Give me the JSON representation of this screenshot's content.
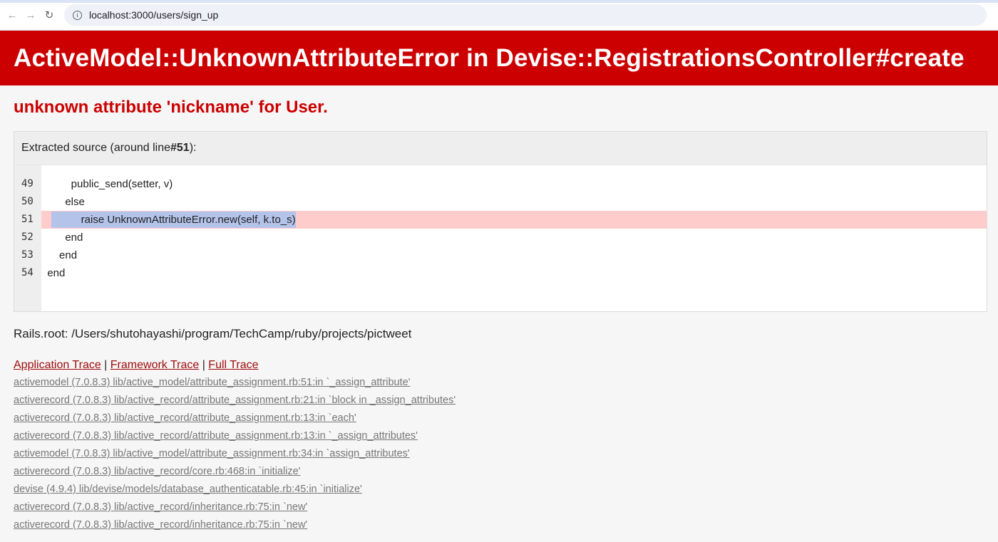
{
  "browser": {
    "url": "localhost:3000/users/sign_up",
    "back_icon": "arrow-left-icon",
    "forward_icon": "arrow-right-icon",
    "reload_icon": "reload-icon"
  },
  "error": {
    "title": "ActiveModel::UnknownAttributeError in Devise::RegistrationsController#create",
    "message": "unknown attribute 'nickname' for User."
  },
  "source": {
    "title_prefix": "Extracted source (around line ",
    "title_line": "#51",
    "title_suffix": "):",
    "line_numbers": [
      "49",
      "50",
      "51",
      "52",
      "53",
      "54"
    ],
    "lines": [
      "          public_send(setter, v)",
      "        else",
      "          raise UnknownAttributeError.new(self, k.to_s)",
      "        end",
      "      end",
      "  end"
    ],
    "highlight_index": 2
  },
  "rails_root": "Rails.root: /Users/shutohayashi/program/TechCamp/ruby/projects/pictweet",
  "trace": {
    "tabs": [
      "Application Trace",
      "Framework Trace",
      "Full Trace"
    ],
    "separator": " | ",
    "lines": [
      "activemodel (7.0.8.3) lib/active_model/attribute_assignment.rb:51:in `_assign_attribute'",
      "activerecord (7.0.8.3) lib/active_record/attribute_assignment.rb:21:in `block in _assign_attributes'",
      "activerecord (7.0.8.3) lib/active_record/attribute_assignment.rb:13:in `each'",
      "activerecord (7.0.8.3) lib/active_record/attribute_assignment.rb:13:in `_assign_attributes'",
      "activemodel (7.0.8.3) lib/active_model/attribute_assignment.rb:34:in `assign_attributes'",
      "activerecord (7.0.8.3) lib/active_record/core.rb:468:in `initialize'",
      "devise (4.9.4) lib/devise/models/database_authenticatable.rb:45:in `initialize'",
      "activerecord (7.0.8.3) lib/active_record/inheritance.rb:75:in `new'",
      "activerecord (7.0.8.3) lib/active_record/inheritance.rb:75:in `new'"
    ]
  },
  "colors": {
    "header_bg": "#cc0000",
    "error_text": "#cc0000",
    "highlight_line": "#ffcccc",
    "selection": "#b4c3ea",
    "trace_link": "#9e0a0a"
  }
}
